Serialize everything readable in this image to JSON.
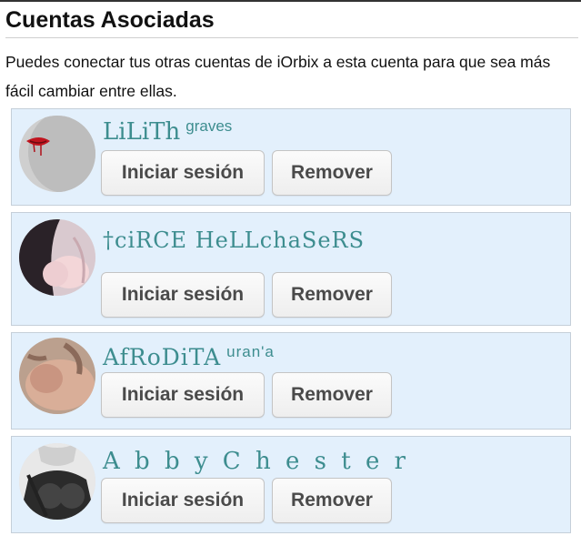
{
  "header": {
    "title": "Cuentas Asociadas",
    "description": "Puedes conectar tus otras cuentas de iOrbix a esta cuenta para que sea más fácil cambiar entre ellas."
  },
  "accounts": [
    {
      "name": "LiLiTh",
      "name_suffix": "graves",
      "login_label": "Iniciar sesión",
      "remove_label": "Remover"
    },
    {
      "name": "†ciRCE HeLLchaSeRS",
      "name_suffix": "",
      "login_label": "Iniciar sesión",
      "remove_label": "Remover"
    },
    {
      "name": "AfRoDiTA",
      "name_suffix": "uran'a",
      "login_label": "Iniciar sesión",
      "remove_label": "Remover"
    },
    {
      "name": "A b b y  C h e s t e r",
      "name_suffix": "",
      "login_label": "Iniciar sesión",
      "remove_label": "Remover"
    }
  ],
  "colors": {
    "card_bg": "#e3f0fc",
    "name_color": "#3d8d8f",
    "button_text": "#4a4a4a"
  }
}
